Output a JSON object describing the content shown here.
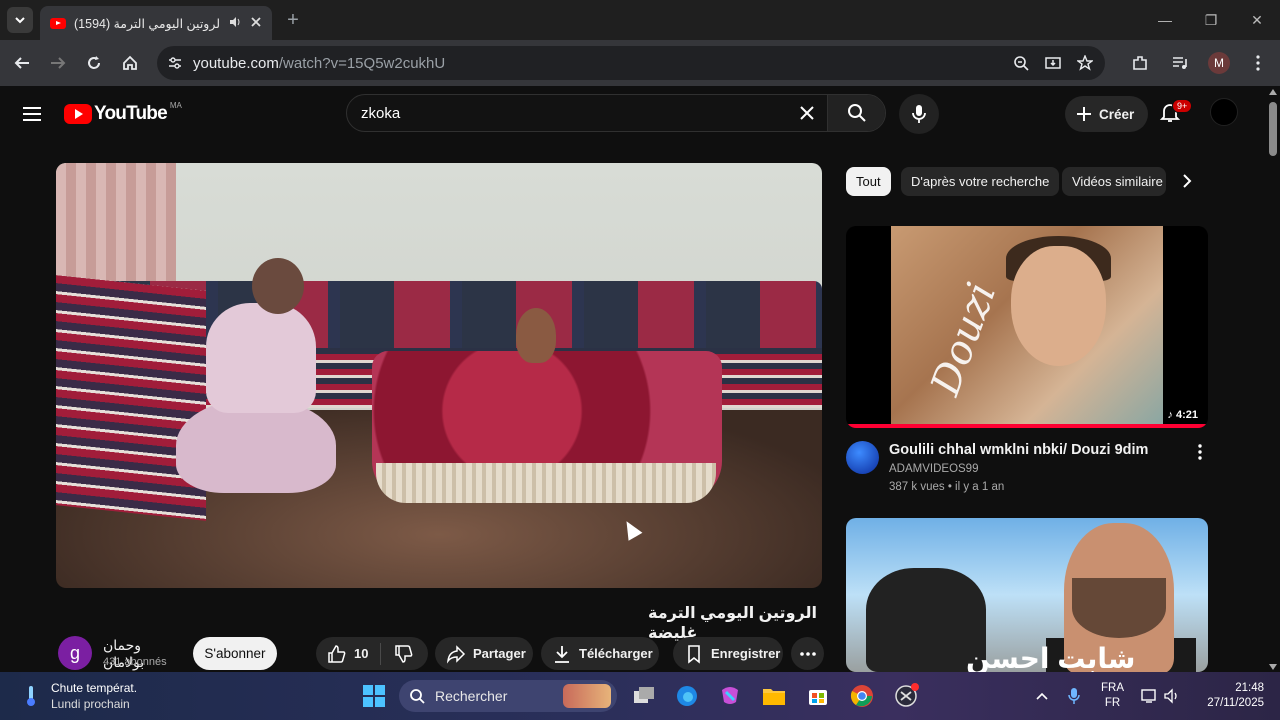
{
  "browser": {
    "tab_title": "(1594) الروتين اليومي الترمة ...",
    "new_tab": "+",
    "url_domain": "youtube.com",
    "url_path": "/watch?v=15Q5w2cukhU",
    "profile_initial": "M"
  },
  "yt_header": {
    "logo_text": "YouTube",
    "country_code": "MA",
    "search_value": "zkoka",
    "create_label": "Créer",
    "notification_badge": "9+"
  },
  "video": {
    "title": "الروتين اليومي الترمة غليضة",
    "channel_initial": "g",
    "channel_name": "وحمان بولامان",
    "subscribers": "431 abonnés",
    "subscribe_label": "S'abonner",
    "likes": "10",
    "share_label": "Partager",
    "download_label": "Télécharger",
    "save_label": "Enregistrer"
  },
  "chips": [
    "Tout",
    "D'après votre recherche",
    "Vidéos similaire"
  ],
  "recommendations": [
    {
      "title": "Goulili chhal wmklni nbki/ Douzi 9dim",
      "channel": "ADAMVIDEOS99",
      "meta": "387 k vues • il y a 1 an",
      "duration": "4:21",
      "thumb_text": "Douzi"
    },
    {
      "thumb_text": "شابت احسن"
    }
  ],
  "taskbar": {
    "weather_main": "Chute températ.",
    "weather_sub": "Lundi prochain",
    "search_label": "Rechercher",
    "lang_top": "FRA",
    "lang_bottom": "FR",
    "time": "21:48",
    "date": "27/11/2025"
  },
  "colors": {
    "youtube_red": "#ff0000",
    "accent_blue": "#4cc2ff",
    "background": "#0f0f0f"
  }
}
